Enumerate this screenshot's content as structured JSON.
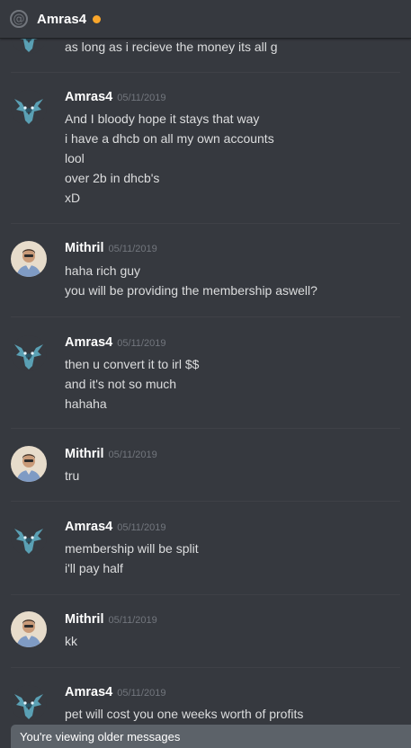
{
  "header": {
    "title": "Amras4",
    "status_color": "#f9a62b"
  },
  "users": {
    "amras": {
      "name": "Amras4",
      "avatar": "dragon-head-icon"
    },
    "mithril": {
      "name": "Mithril",
      "avatar": "user-photo-avatar"
    }
  },
  "messages": [
    {
      "user": "Amras4",
      "time": "",
      "lines": [
        "as long as i recieve the money its all g"
      ]
    },
    {
      "user": "Amras4",
      "time": "05/11/2019",
      "lines": [
        "And I bloody hope it stays that way",
        "i have a dhcb on all my own accounts",
        "lool",
        "over 2b in dhcb's",
        "xD"
      ]
    },
    {
      "user": "Mithril",
      "time": "05/11/2019",
      "lines": [
        "haha rich guy",
        "you will be providing the membership aswell?"
      ]
    },
    {
      "user": "Amras4",
      "time": "05/11/2019",
      "lines": [
        "then u convert it to irl $$",
        "and it's not so much",
        "hahaha"
      ]
    },
    {
      "user": "Mithril",
      "time": "05/11/2019",
      "lines": [
        "tru"
      ]
    },
    {
      "user": "Amras4",
      "time": "05/11/2019",
      "lines": [
        "membership will be split",
        "i'll pay half"
      ]
    },
    {
      "user": "Mithril",
      "time": "05/11/2019",
      "lines": [
        "kk"
      ]
    },
    {
      "user": "Amras4",
      "time": "05/11/2019",
      "lines": [
        "pet will cost you one weeks worth of profits"
      ]
    }
  ],
  "banner": {
    "text": "You're viewing older messages"
  }
}
